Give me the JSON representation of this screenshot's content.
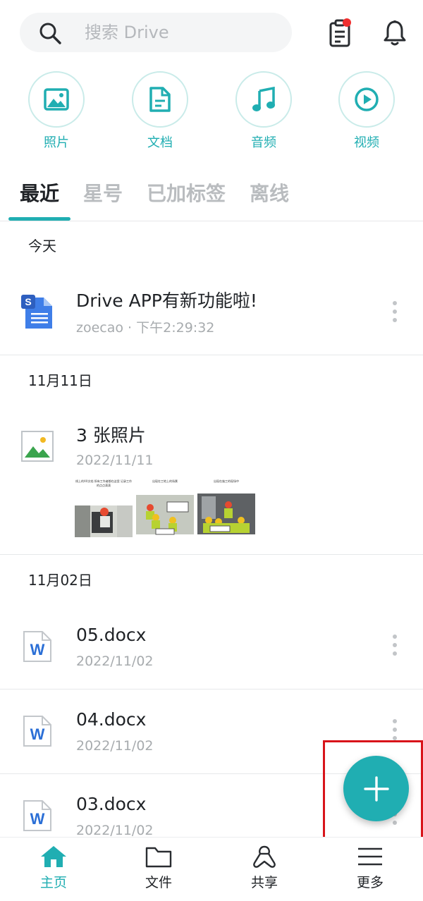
{
  "search": {
    "placeholder": "搜索 Drive"
  },
  "categories": [
    {
      "label": "照片",
      "icon": "image-icon"
    },
    {
      "label": "文档",
      "icon": "document-icon"
    },
    {
      "label": "音频",
      "icon": "music-icon"
    },
    {
      "label": "视频",
      "icon": "play-icon"
    }
  ],
  "tabs": [
    {
      "label": "最近",
      "active": true
    },
    {
      "label": "星号",
      "active": false
    },
    {
      "label": "已加标签",
      "active": false
    },
    {
      "label": "离线",
      "active": false
    }
  ],
  "sections": [
    {
      "header": "今天",
      "items": [
        {
          "title": "Drive APP有新功能啦!",
          "meta": "zoecao · 下午2:29:32",
          "icon": "slides-doc-icon"
        }
      ]
    },
    {
      "header": "11月11日",
      "items": [
        {
          "title": "3 张照片",
          "meta": "2022/11/11",
          "icon": "image-file-icon",
          "thumbnails": [
            {
              "caption": "线上的XX文档 所有工作者都在这里 记录工作的点点滴滴"
            },
            {
              "caption": "出现在工地上的场景"
            },
            {
              "caption": "出现在施工的现场中"
            }
          ]
        }
      ]
    },
    {
      "header": "11月02日",
      "items": [
        {
          "title": "05.docx",
          "meta": "2022/11/02",
          "icon": "word-doc-icon"
        },
        {
          "title": "04.docx",
          "meta": "2022/11/02",
          "icon": "word-doc-icon"
        },
        {
          "title": "03.docx",
          "meta": "2022/11/02",
          "icon": "word-doc-icon"
        }
      ]
    }
  ],
  "bottom_nav": [
    {
      "label": "主页",
      "icon": "home-icon",
      "active": true
    },
    {
      "label": "文件",
      "icon": "folder-icon",
      "active": false
    },
    {
      "label": "共享",
      "icon": "share-icon",
      "active": false
    },
    {
      "label": "更多",
      "icon": "menu-icon",
      "active": false
    }
  ],
  "colors": {
    "accent": "#20aeb2",
    "highlight": "#d8141a",
    "notification": "#ef2f2f",
    "word_blue": "#2b6fd6",
    "slides_blue": "#3f7ee8"
  }
}
